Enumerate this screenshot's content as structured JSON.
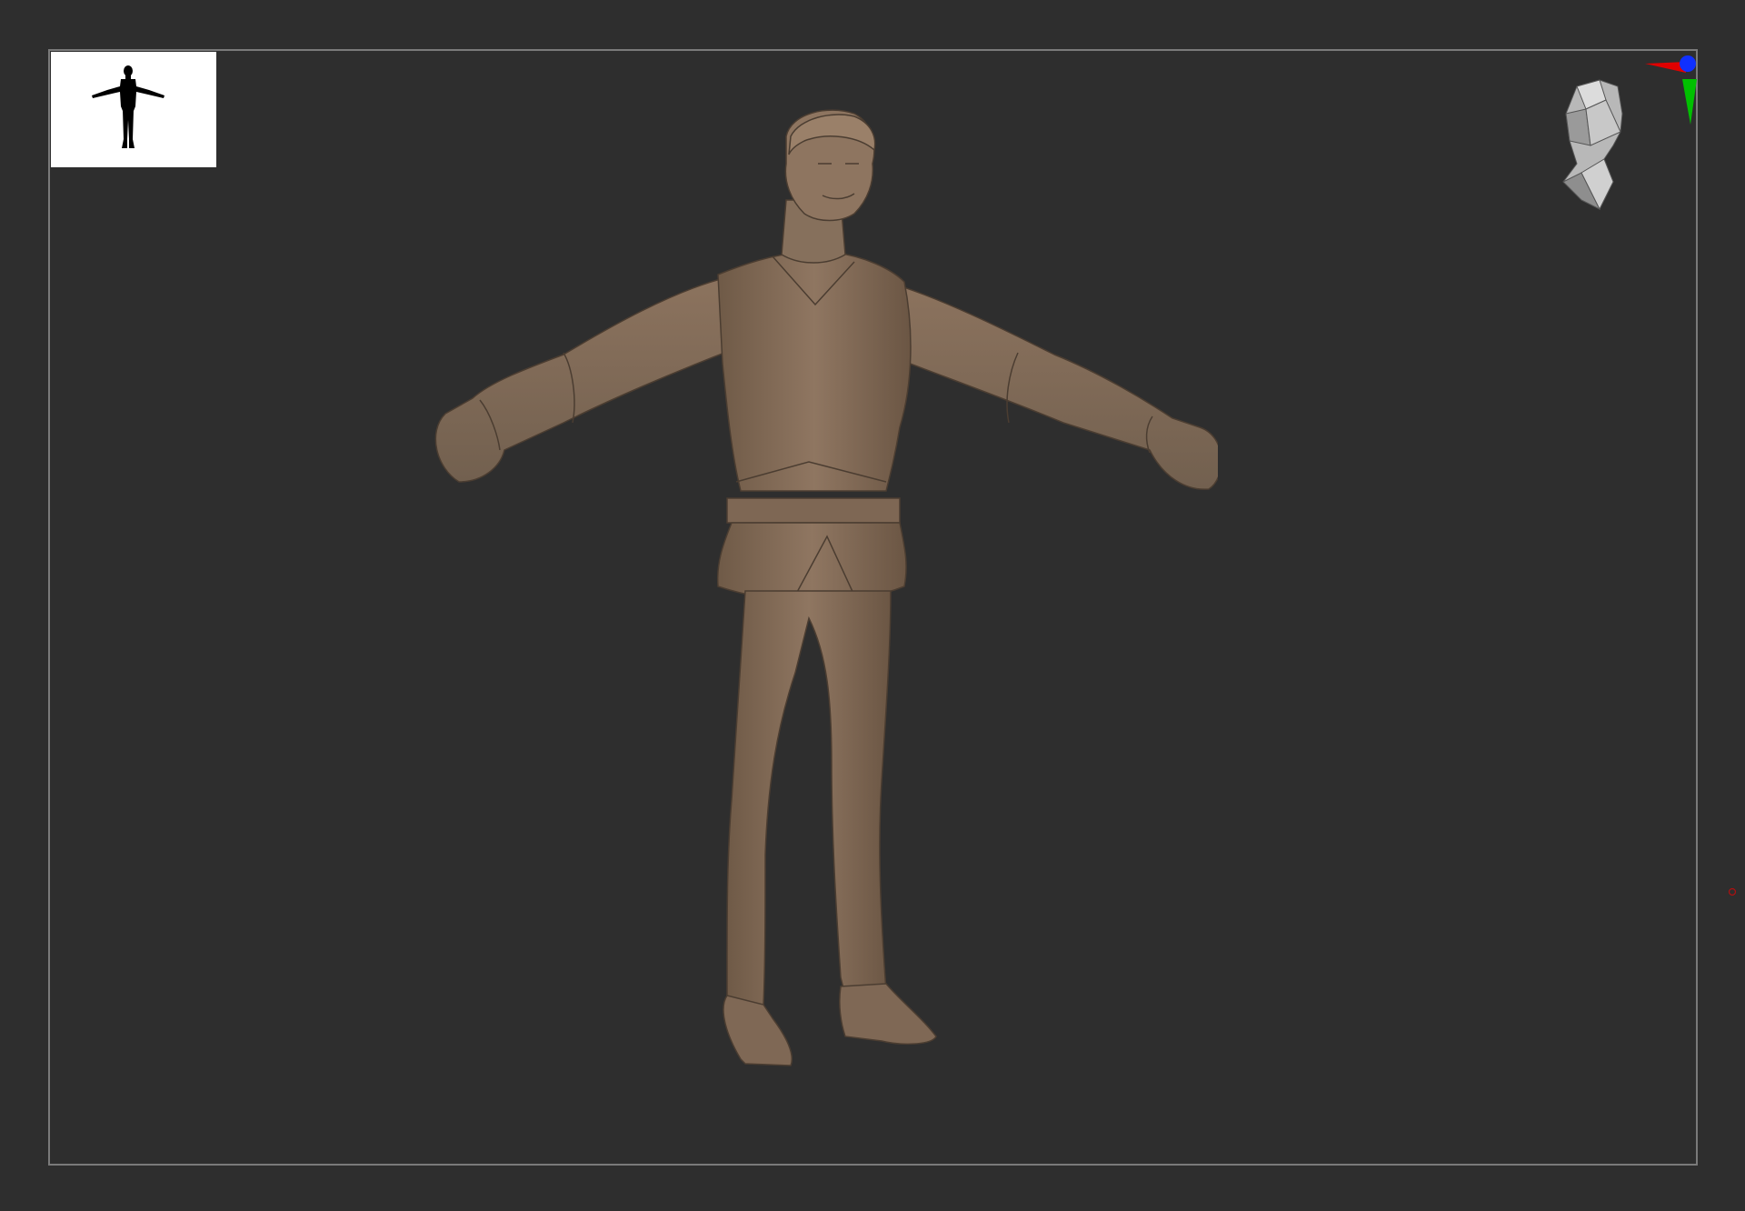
{
  "viewport": {
    "background_color": "#2e2e2e",
    "frame_color": "#7a7a7a",
    "model_color": "#8a715c"
  },
  "thumbnail": {
    "icon": "t-pose-silhouette-icon"
  },
  "navigator": {
    "icon": "head-navigation-cube-icon",
    "axes": [
      {
        "name": "x-axis",
        "color": "#e00000"
      },
      {
        "name": "y-axis",
        "color": "#00c000"
      },
      {
        "name": "z-axis",
        "color": "#1030ff"
      }
    ]
  },
  "marker": {
    "icon": "red-circle-marker-icon",
    "color": "#b01010"
  }
}
